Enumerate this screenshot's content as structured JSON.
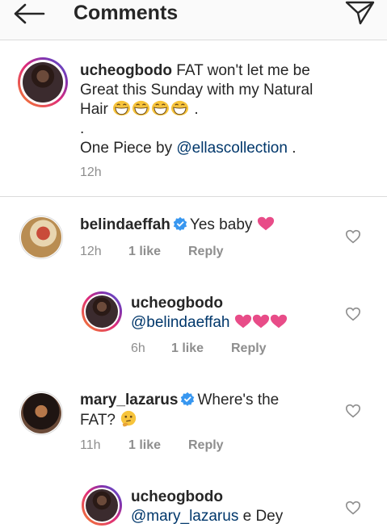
{
  "header": {
    "title": "Comments"
  },
  "caption": {
    "username": "ucheogbodo",
    "line1_rest": "FAT won't let me be",
    "line2": "Great this Sunday with my Natural",
    "line3": "Hair",
    "dot": ".",
    "line5_prefix": "One Piece by",
    "mention": "@ellascollection",
    "line5_suffix": " .",
    "time": "12h"
  },
  "comments": [
    {
      "username": "belindaeffah",
      "text": "Yes baby",
      "time": "12h",
      "likes": "1 like",
      "reply": "Reply",
      "reply_item": {
        "username": "ucheogbodo",
        "mention": "@belindaeffah",
        "time": "6h",
        "likes": "1 like",
        "reply": "Reply"
      }
    },
    {
      "username": "mary_lazarus",
      "text_line1": "Where's the",
      "text_line2": "FAT?",
      "time": "11h",
      "likes": "1 like",
      "reply": "Reply",
      "reply_item": {
        "username": "ucheogbodo",
        "mention": "@mary_lazarus",
        "text": " e Dey"
      }
    }
  ],
  "colors": {
    "text": "#262626",
    "muted": "#8e8e8e",
    "mention": "#00376b",
    "verified": "#3897f0",
    "heart_emoji": "#e84c88",
    "divider": "#dbdbdb"
  }
}
